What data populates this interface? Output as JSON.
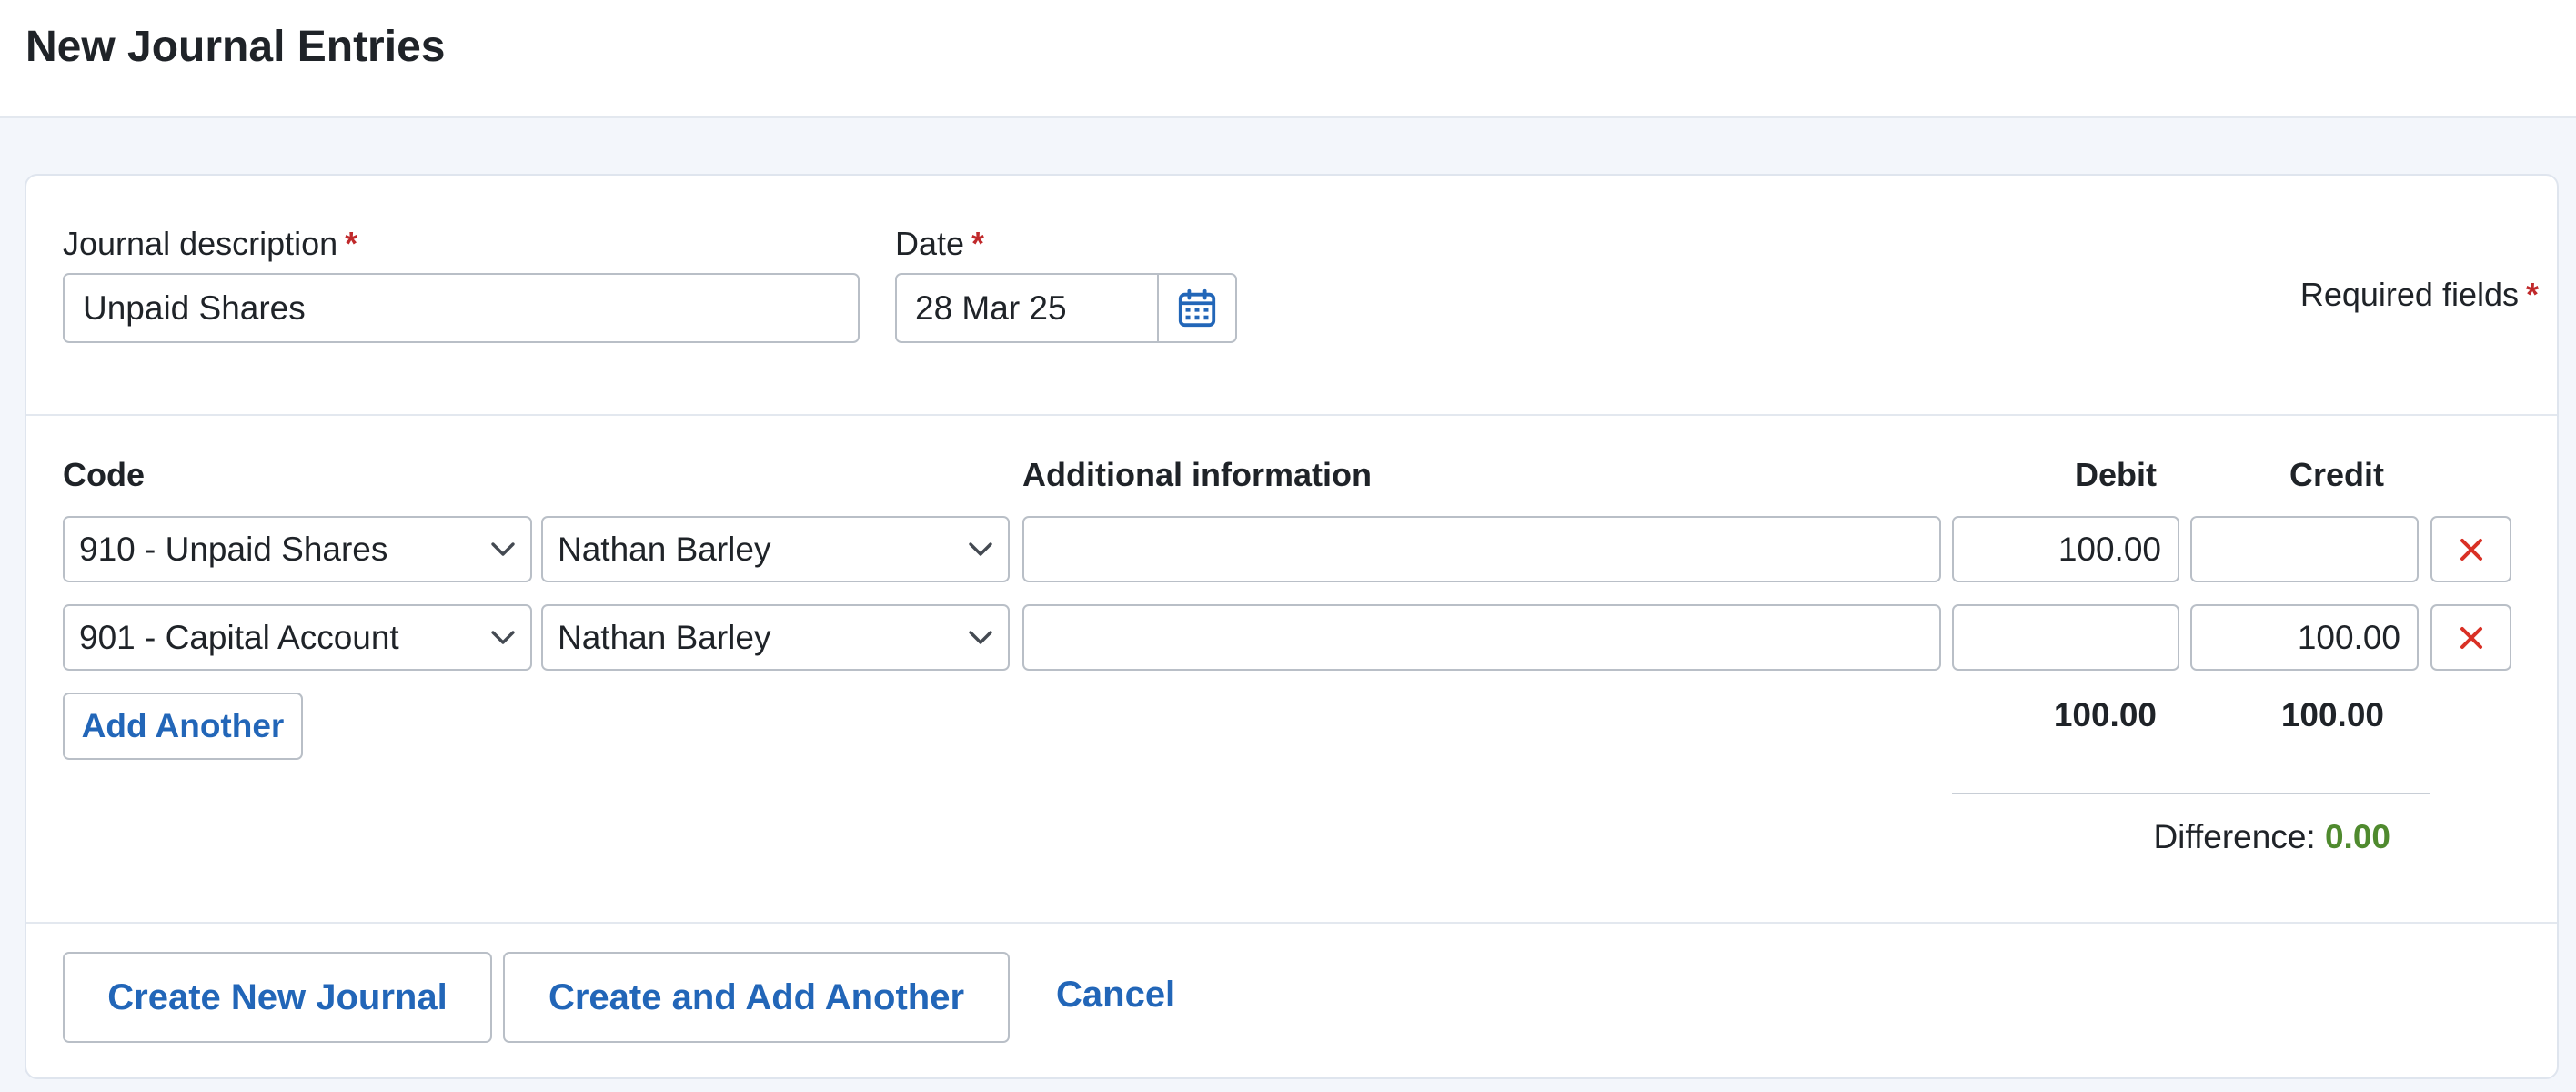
{
  "page": {
    "title": "New Journal Entries"
  },
  "form": {
    "description_label": "Journal description",
    "description_value": "Unpaid Shares",
    "date_label": "Date",
    "date_value": "28 Mar 25",
    "required_asterisk": "*",
    "required_note": "Required fields"
  },
  "table": {
    "headers": {
      "code": "Code",
      "additional": "Additional information",
      "debit": "Debit",
      "credit": "Credit"
    },
    "rows": [
      {
        "code": "910 - Unpaid Shares",
        "contact": "Nathan Barley",
        "additional": "",
        "debit": "100.00",
        "credit": ""
      },
      {
        "code": "901 - Capital Account",
        "contact": "Nathan Barley",
        "additional": "",
        "debit": "",
        "credit": "100.00"
      }
    ],
    "add_another_label": "Add Another",
    "totals": {
      "debit": "100.00",
      "credit": "100.00"
    },
    "difference_label": "Difference:",
    "difference_value": "0.00"
  },
  "actions": {
    "create_label": "Create New Journal",
    "create_add_label": "Create and Add Another",
    "cancel_label": "Cancel"
  },
  "colors": {
    "accent": "#2266b8",
    "required": "#c0292b",
    "delete": "#d93025",
    "difference_ok": "#4f8a2e"
  },
  "icons": {
    "date_picker": "calendar-icon",
    "select_arrow": "chevron-down-icon",
    "delete_row": "close-icon"
  }
}
